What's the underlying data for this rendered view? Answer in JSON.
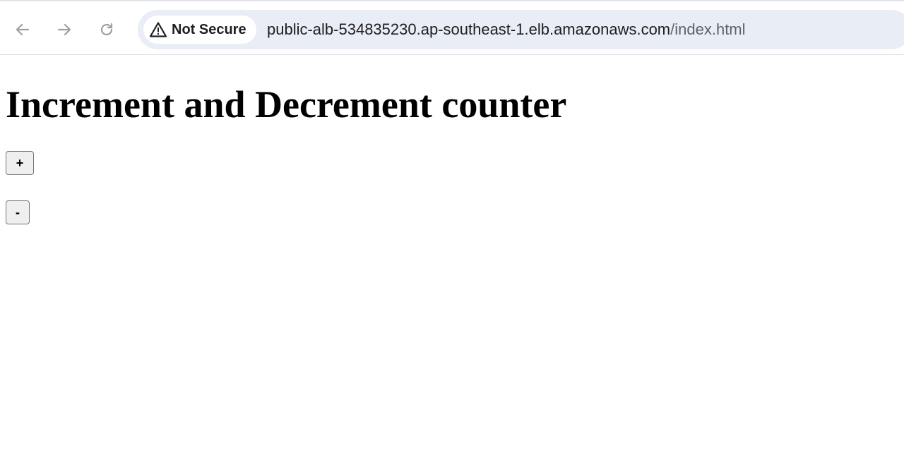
{
  "browser": {
    "back_icon": "arrow-left-icon",
    "forward_icon": "arrow-right-icon",
    "reload_icon": "reload-icon",
    "security": {
      "icon": "warning-triangle-icon",
      "label": "Not Secure"
    },
    "url": {
      "host": "public-alb-534835230.ap-southeast-1.elb.amazonaws.com",
      "path": "/index.html"
    }
  },
  "page": {
    "heading": "Increment and Decrement counter",
    "increment_label": "+",
    "decrement_label": "-"
  },
  "colors": {
    "omnibox_bg": "#e9edf5",
    "icon_gray": "#9aa0a6",
    "button_bg": "#efefef"
  }
}
